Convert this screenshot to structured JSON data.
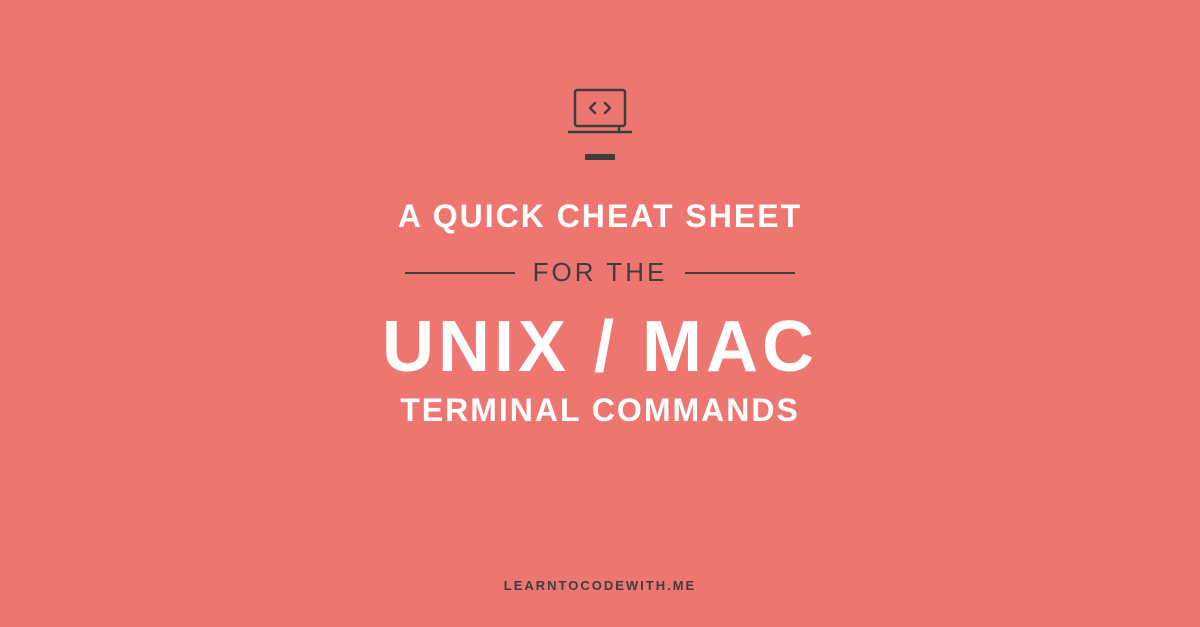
{
  "icon_name": "laptop-code-icon",
  "title_line_1": "A QUICK CHEAT SHEET",
  "subline_text": "FOR THE",
  "title_line_2": "UNIX / MAC",
  "title_line_3": "TERMINAL COMMANDS",
  "brand": "LEARNTOCODEWITH.ME",
  "colors": {
    "background": "#ee7670",
    "text_light": "#ffffff",
    "text_dark": "#3e3e3e"
  }
}
